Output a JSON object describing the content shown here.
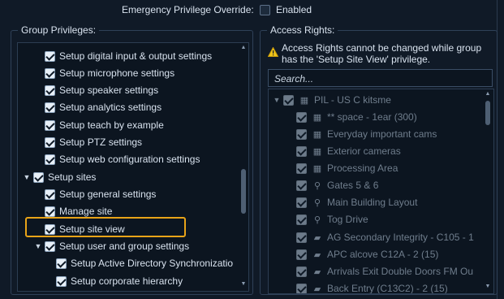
{
  "top": {
    "override_label": "Emergency Privilege Override:",
    "override_value": "Enabled"
  },
  "group_privileges": {
    "title": "Group Privileges:",
    "items": [
      {
        "label": "Setup digital input & output settings"
      },
      {
        "label": "Setup microphone settings"
      },
      {
        "label": "Setup speaker settings"
      },
      {
        "label": "Setup analytics settings"
      },
      {
        "label": "Setup teach by example"
      },
      {
        "label": "Setup PTZ settings"
      },
      {
        "label": "Setup web configuration settings"
      },
      {
        "label": "Setup sites"
      },
      {
        "label": "Setup general settings"
      },
      {
        "label": "Manage site"
      },
      {
        "label": "Setup site view"
      },
      {
        "label": "Setup user and group settings"
      },
      {
        "label": "Setup Active Directory Synchronizatio"
      },
      {
        "label": "Setup corporate hierarchy"
      }
    ]
  },
  "access_rights": {
    "title": "Access Rights:",
    "warning": "Access Rights cannot be changed while group has the 'Setup Site View' privilege.",
    "search_placeholder": "Search...",
    "items": [
      {
        "label": "PIL - US C kitsme",
        "icon": "server-icon"
      },
      {
        "label": "** space - 1ear (300)",
        "icon": "camera-group-icon"
      },
      {
        "label": "Everyday important cams",
        "icon": "camera-group-icon"
      },
      {
        "label": "Exterior cameras",
        "icon": "camera-group-icon"
      },
      {
        "label": "Processing Area",
        "icon": "camera-group-icon"
      },
      {
        "label": "Gates 5 & 6",
        "icon": "map-pin-icon"
      },
      {
        "label": "Main Building Layout",
        "icon": "map-pin-icon"
      },
      {
        "label": "Tog Drive",
        "icon": "map-pin-icon"
      },
      {
        "label": "AG Secondary Integrity - C105 - 1",
        "icon": "camera-icon"
      },
      {
        "label": "APC alcove C12A - 2 (15)",
        "icon": "camera-icon"
      },
      {
        "label": "Arrivals Exit Double Doors FM Ou",
        "icon": "camera-icon"
      },
      {
        "label": "Back Entry (C13C2) - 2 (15)",
        "icon": "camera-icon"
      }
    ]
  }
}
